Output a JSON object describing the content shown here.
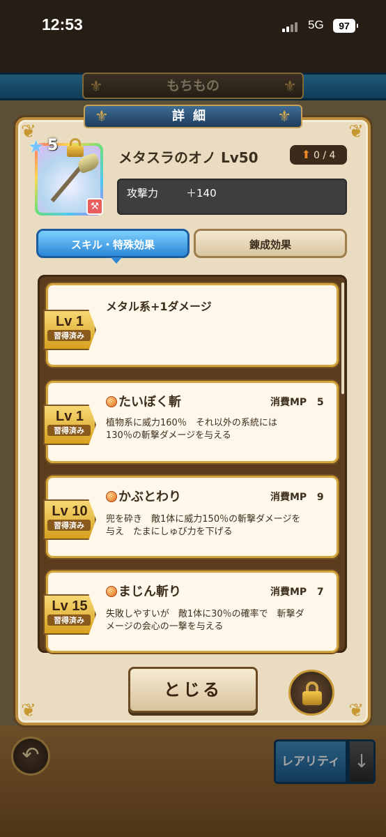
{
  "status": {
    "time": "12:53",
    "network": "5G",
    "battery": "97"
  },
  "background": {
    "title": "もちもの",
    "rarity_button": "レアリティ",
    "back_icon": "undo-arrow-icon",
    "sort_icon": "down-arrow-icon"
  },
  "dialog": {
    "title": "詳細",
    "item": {
      "name": "メタスラのオノ Lv50",
      "stars": "5",
      "upgrade": "0 / 4",
      "upgrade_icon": "up-arrow-icon",
      "stat_label": "攻撃力",
      "stat_value": "＋140",
      "type_icon": "axe-type-icon"
    },
    "tabs": [
      {
        "label": "スキル・特殊効果",
        "active": true
      },
      {
        "label": "錬成効果",
        "active": false
      }
    ],
    "skills": [
      {
        "level": "Lv 1",
        "status": "習得済み",
        "name": "メタル系+1ダメージ",
        "mp_label": "",
        "mp_value": "",
        "desc_line1": "",
        "desc_line2": ""
      },
      {
        "level": "Lv 1",
        "status": "習得済み",
        "name": "たいぼく斬",
        "mp_label": "消費MP",
        "mp_value": "5",
        "desc_line1": "植物系に威力160％　それ以外の系統には",
        "desc_line2": "130％の斬撃ダメージを与える"
      },
      {
        "level": "Lv 10",
        "status": "習得済み",
        "name": "かぶとわり",
        "mp_label": "消費MP",
        "mp_value": "9",
        "desc_line1": "兜を砕き　敵1体に威力150％の斬撃ダメージを",
        "desc_line2": "与え　たまにしゅび力を下げる"
      },
      {
        "level": "Lv 15",
        "status": "習得済み",
        "name": "まじん斬り",
        "mp_label": "消費MP",
        "mp_value": "7",
        "desc_line1": "失敗しやすいが　敵1体に30％の確率で　斬撃ダ",
        "desc_line2": "メージの会心の一撃を与える"
      }
    ],
    "close_button": "とじる",
    "lock_icon": "lock-icon"
  }
}
